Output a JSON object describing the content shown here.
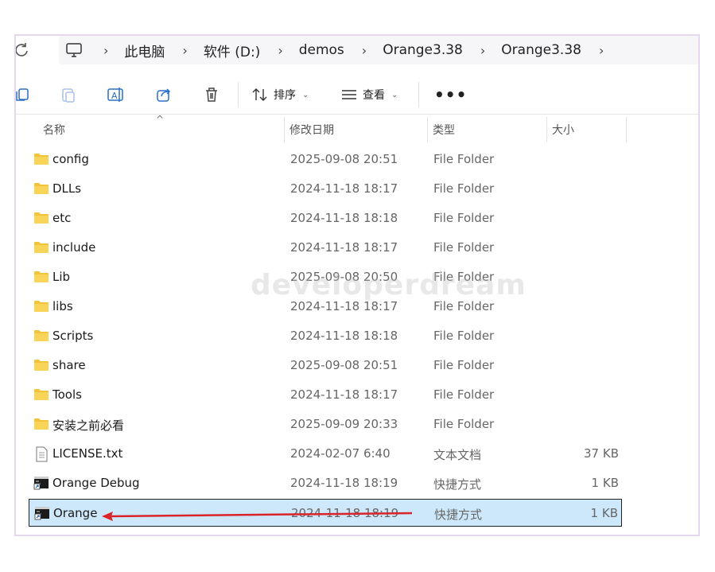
{
  "breadcrumb": {
    "items": [
      "此电脑",
      "软件 (D:)",
      "demos",
      "Orange3.38",
      "Orange3.38"
    ]
  },
  "toolbar": {
    "sort_label": "排序",
    "view_label": "查看",
    "more_label": "•••"
  },
  "columns": {
    "name": "名称",
    "modified": "修改日期",
    "type": "类型",
    "size": "大小"
  },
  "files": [
    {
      "name": "config",
      "date": "2025-09-08 20:51",
      "type": "File Folder",
      "size": "",
      "icon": "folder-icon"
    },
    {
      "name": "DLLs",
      "date": "2024-11-18 18:17",
      "type": "File Folder",
      "size": "",
      "icon": "folder-icon"
    },
    {
      "name": "etc",
      "date": "2024-11-18 18:18",
      "type": "File Folder",
      "size": "",
      "icon": "folder-icon"
    },
    {
      "name": "include",
      "date": "2024-11-18 18:17",
      "type": "File Folder",
      "size": "",
      "icon": "folder-icon"
    },
    {
      "name": "Lib",
      "date": "2025-09-08 20:50",
      "type": "File Folder",
      "size": "",
      "icon": "folder-icon"
    },
    {
      "name": "libs",
      "date": "2024-11-18 18:17",
      "type": "File Folder",
      "size": "",
      "icon": "folder-icon"
    },
    {
      "name": "Scripts",
      "date": "2024-11-18 18:18",
      "type": "File Folder",
      "size": "",
      "icon": "folder-icon"
    },
    {
      "name": "share",
      "date": "2025-09-08 20:51",
      "type": "File Folder",
      "size": "",
      "icon": "folder-icon"
    },
    {
      "name": "Tools",
      "date": "2024-11-18 18:17",
      "type": "File Folder",
      "size": "",
      "icon": "folder-icon"
    },
    {
      "name": "安装之前必看",
      "date": "2025-09-09 20:33",
      "type": "File Folder",
      "size": "",
      "icon": "folder-icon"
    },
    {
      "name": "LICENSE.txt",
      "date": "2024-02-07 6:40",
      "type": "文本文档",
      "size": "37 KB",
      "icon": "text-file-icon"
    },
    {
      "name": "Orange Debug",
      "date": "2024-11-18 18:19",
      "type": "快捷方式",
      "size": "1 KB",
      "icon": "shortcut-icon"
    },
    {
      "name": "Orange",
      "date": "2024-11-18 18:19",
      "type": "快捷方式",
      "size": "1 KB",
      "icon": "shortcut-icon",
      "selected": true
    }
  ],
  "watermark": "developerdream",
  "colors": {
    "selection": "#cde8fa",
    "folder": "#f3c43a",
    "arrow": "#d9242a"
  }
}
